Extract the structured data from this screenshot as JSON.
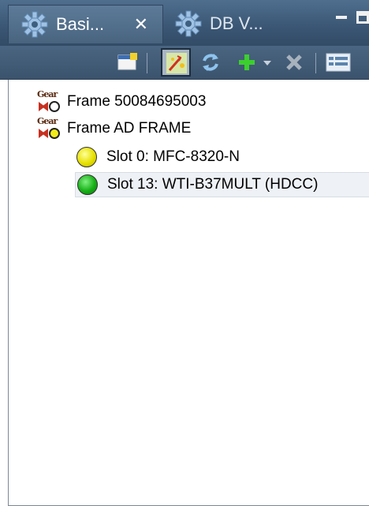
{
  "tabs": [
    {
      "label": "Basi...",
      "close_symbol": "✕",
      "icon": "gear-icon",
      "active": true
    },
    {
      "label": "DB V...",
      "icon": "gear-icon",
      "active": false
    }
  ],
  "window_controls": {
    "minimize": "minimize-icon",
    "maximize": "maximize-icon"
  },
  "toolbar": {
    "buttons": [
      "new-window-icon",
      "auto-discover-icon",
      "refresh-icon",
      "add-icon",
      "dropdown-arrow-icon",
      "delete-icon",
      "layout-icon"
    ]
  },
  "tree": {
    "items": [
      {
        "label": "Frame 50084695003",
        "status": "gray",
        "level": 0
      },
      {
        "label": "Frame AD FRAME",
        "status": "yellow",
        "level": 0
      },
      {
        "label": "Slot 0: MFC-8320-N",
        "status": "yellow",
        "level": 1
      },
      {
        "label": "Slot 13: WTI-B37MULT (HDCC)",
        "status": "green",
        "level": 1,
        "selected": true
      }
    ],
    "gear_text": "Gear"
  },
  "colors": {
    "tab_bar": "#3a5674",
    "status_yellow": "#e6e000",
    "status_green": "#16b016",
    "add_green": "#3ccf2e"
  }
}
